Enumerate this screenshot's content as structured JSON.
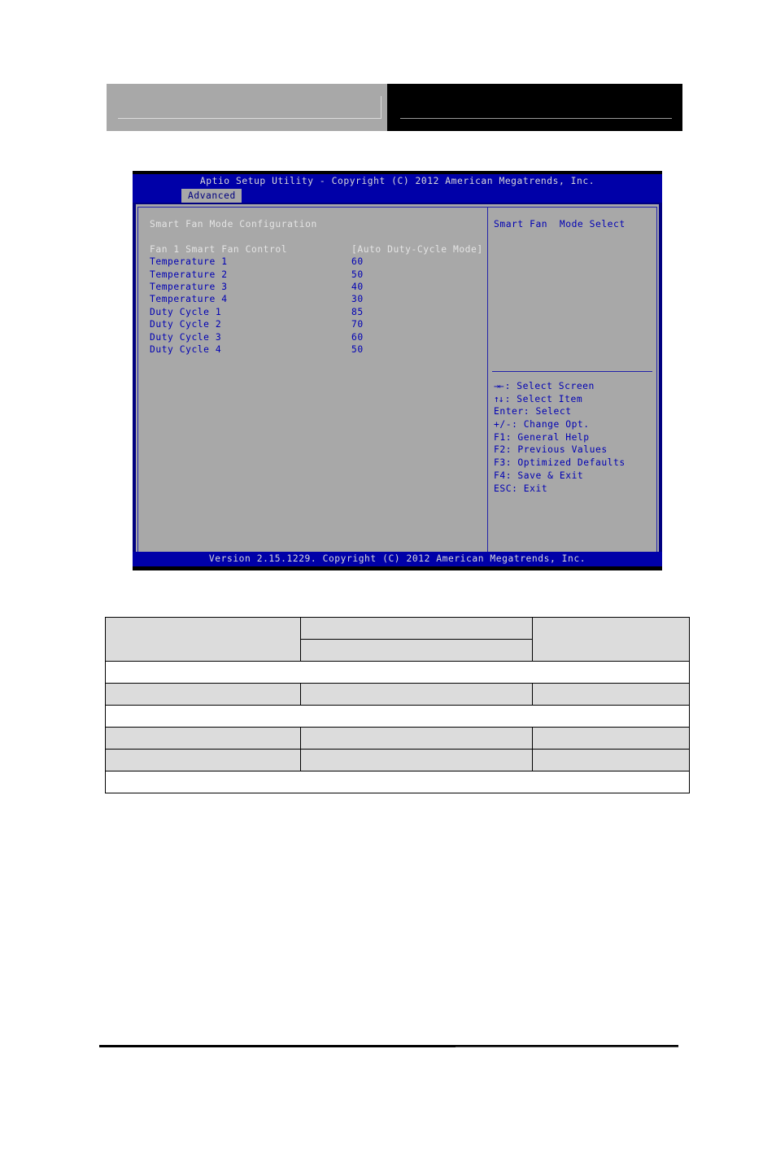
{
  "page": {
    "header": {
      "left_block_label": "",
      "right_block_label": ""
    }
  },
  "bios": {
    "title": "Aptio Setup Utility - Copyright (C) 2012 American Megatrends, Inc.",
    "active_tab": "Advanced",
    "section_title": "Smart Fan Mode Configuration",
    "settings": [
      {
        "label": "Fan 1 Smart Fan Control",
        "value": "[Auto Duty-Cycle Mode]",
        "style": "white"
      },
      {
        "label": "Temperature 1",
        "value": "60",
        "style": "blue"
      },
      {
        "label": "Temperature 2",
        "value": "50",
        "style": "blue"
      },
      {
        "label": "Temperature 3",
        "value": "40",
        "style": "blue"
      },
      {
        "label": "Temperature 4",
        "value": "30",
        "style": "blue"
      },
      {
        "label": "Duty Cycle 1",
        "value": "85",
        "style": "blue"
      },
      {
        "label": "Duty Cycle 2",
        "value": "70",
        "style": "blue"
      },
      {
        "label": "Duty Cycle 3",
        "value": "60",
        "style": "blue"
      },
      {
        "label": "Duty Cycle 4",
        "value": "50",
        "style": "blue"
      }
    ],
    "help_text": "Smart Fan  Mode Select",
    "keys": [
      {
        "key": "→←",
        "action": ": Select Screen"
      },
      {
        "key": "↑↓",
        "action": ": Select Item"
      },
      {
        "key": "Enter",
        "action": ": Select"
      },
      {
        "key": "+/-",
        "action": ": Change Opt."
      },
      {
        "key": "F1",
        "action": ": General Help"
      },
      {
        "key": "F2",
        "action": ": Previous Values"
      },
      {
        "key": "F3",
        "action": ": Optimized Defaults"
      },
      {
        "key": "F4",
        "action": ": Save & Exit"
      },
      {
        "key": "ESC",
        "action": ": Exit"
      }
    ],
    "footer": "Version 2.15.1229. Copyright (C) 2012 American Megatrends, Inc.",
    "colors": {
      "chrome_blue": "#0000a8",
      "panel_gray": "#a8a8a8",
      "text_blue": "#0000b4",
      "text_light": "#e4e4e4"
    }
  },
  "spec_table": {
    "rows": [
      {
        "cells": [
          {
            "text": "",
            "shaded": true,
            "rowspan": 2,
            "height": "h-tall"
          },
          {
            "text": "",
            "shaded": true,
            "height": "h-mid"
          },
          {
            "text": "",
            "shaded": true,
            "rowspan": 2,
            "height": "h-tall"
          }
        ]
      },
      {
        "cells": [
          {
            "text": "",
            "shaded": true,
            "height": "h-mid"
          }
        ]
      },
      {
        "cells": [
          {
            "text": "",
            "shaded": false,
            "colspan": 3,
            "height": "h-desc"
          }
        ]
      },
      {
        "cells": [
          {
            "text": "",
            "shaded": true,
            "height": "h-mid"
          },
          {
            "text": "",
            "shaded": true,
            "height": "h-mid"
          },
          {
            "text": "",
            "shaded": true,
            "height": "h-mid"
          }
        ]
      },
      {
        "cells": [
          {
            "text": "",
            "shaded": false,
            "colspan": 3,
            "height": "h-desc"
          }
        ]
      },
      {
        "cells": [
          {
            "text": "",
            "shaded": true,
            "height": "h-mid"
          },
          {
            "text": "",
            "shaded": true,
            "height": "h-mid"
          },
          {
            "text": "",
            "shaded": true,
            "height": "h-mid"
          }
        ]
      },
      {
        "cells": [
          {
            "text": "",
            "shaded": true,
            "height": "h-mid"
          },
          {
            "text": "",
            "shaded": true,
            "height": "h-mid"
          },
          {
            "text": "",
            "shaded": true,
            "height": "h-mid"
          }
        ]
      },
      {
        "cells": [
          {
            "text": "",
            "shaded": false,
            "colspan": 3,
            "height": "h-note"
          }
        ]
      }
    ]
  }
}
